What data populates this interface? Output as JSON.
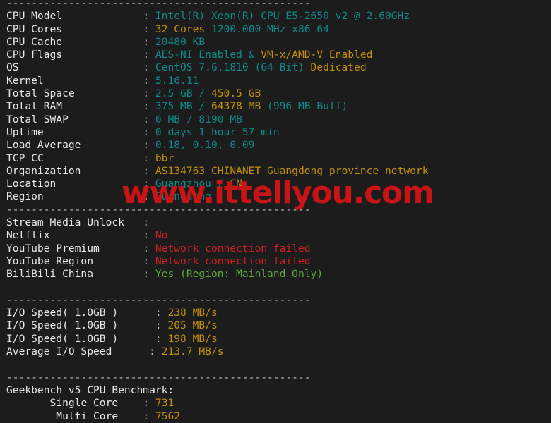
{
  "terminal": {
    "background": "#1c1c1c",
    "colors": {
      "label": "#e8e8e8",
      "teal": "#0e8a8a",
      "yellow": "#c3900c",
      "red": "#cc2222",
      "green": "#5fa83c",
      "dash": "#bdbdbd"
    },
    "separator": "-------------------------------------------------",
    "rows": {
      "cpu_model": {
        "label": "CPU Model",
        "value": "Intel(R) Xeon(R) CPU E5-2650 v2 @ 2.60GHz"
      },
      "cpu_cores_a": {
        "label": "CPU Cores",
        "value": "32 Cores"
      },
      "cpu_cores_b": {
        "value": "1200.000 MHz x86_64"
      },
      "cpu_cache": {
        "label": "CPU Cache",
        "value": "20480 KB"
      },
      "cpu_flags_a": {
        "label": "CPU Flags",
        "value": "AES-NI Enabled & "
      },
      "cpu_flags_b": {
        "value": "VM-x/AMD-V Enabled"
      },
      "os_a": {
        "label": "OS",
        "value": "CentOS 7.6.1810 (64 Bit) "
      },
      "os_b": {
        "value": "Dedicated"
      },
      "kernel": {
        "label": "Kernel",
        "value": "5.16.11"
      },
      "total_space_a": {
        "label": "Total Space",
        "value": "2.5 GB / "
      },
      "total_space_b": {
        "value": "450.5 GB"
      },
      "total_ram_a": {
        "label": "Total RAM",
        "value": "375 MB / "
      },
      "total_ram_b": {
        "value": "64378 MB"
      },
      "total_ram_c": {
        "value": " (996 MB Buff)"
      },
      "total_swap": {
        "label": "Total SWAP",
        "value": "0 MB / 8190 MB"
      },
      "uptime": {
        "label": "Uptime",
        "value": "0 days 1 hour 57 min"
      },
      "load_average": {
        "label": "Load Average",
        "value": "0.18, 0.10, 0.09"
      },
      "tcp_cc": {
        "label": "TCP CC",
        "value": "bbr"
      },
      "organization": {
        "label": "Organization",
        "value": "AS134763 CHINANET Guangdong province network"
      },
      "location_a": {
        "label": "Location",
        "value": "Guangzhou / "
      },
      "location_b": {
        "value": "CN"
      },
      "region": {
        "label": "Region",
        "value": "Guangdong"
      },
      "stream_media": {
        "label": "Stream Media Unlock",
        "value": ""
      },
      "netflix": {
        "label": "Netflix",
        "value": "No"
      },
      "yt_premium": {
        "label": "YouTube Premium",
        "value": "Network connection failed"
      },
      "yt_region": {
        "label": "YouTube Region",
        "value": "Network connection failed"
      },
      "bilibili": {
        "label": "BiliBili China",
        "value": "Yes (Region: Mainland Only)"
      },
      "io_1": {
        "label": "I/O Speed( 1.0GB )",
        "value": "238 MB/s"
      },
      "io_2": {
        "label": "I/O Speed( 1.0GB )",
        "value": "205 MB/s"
      },
      "io_3": {
        "label": "I/O Speed( 1.0GB )",
        "value": "198 MB/s"
      },
      "io_avg": {
        "label": "Average I/O Speed",
        "value": "213.7 MB/s"
      },
      "geekbench_title": {
        "label": "Geekbench v5 CPU Benchmark:"
      },
      "single_core": {
        "label": "Single Core",
        "value": "731"
      },
      "multi_core": {
        "label": "Multi Core",
        "value": "7562"
      }
    }
  },
  "watermark": {
    "text": "www.ittellyou.com",
    "color": "#c81414"
  }
}
